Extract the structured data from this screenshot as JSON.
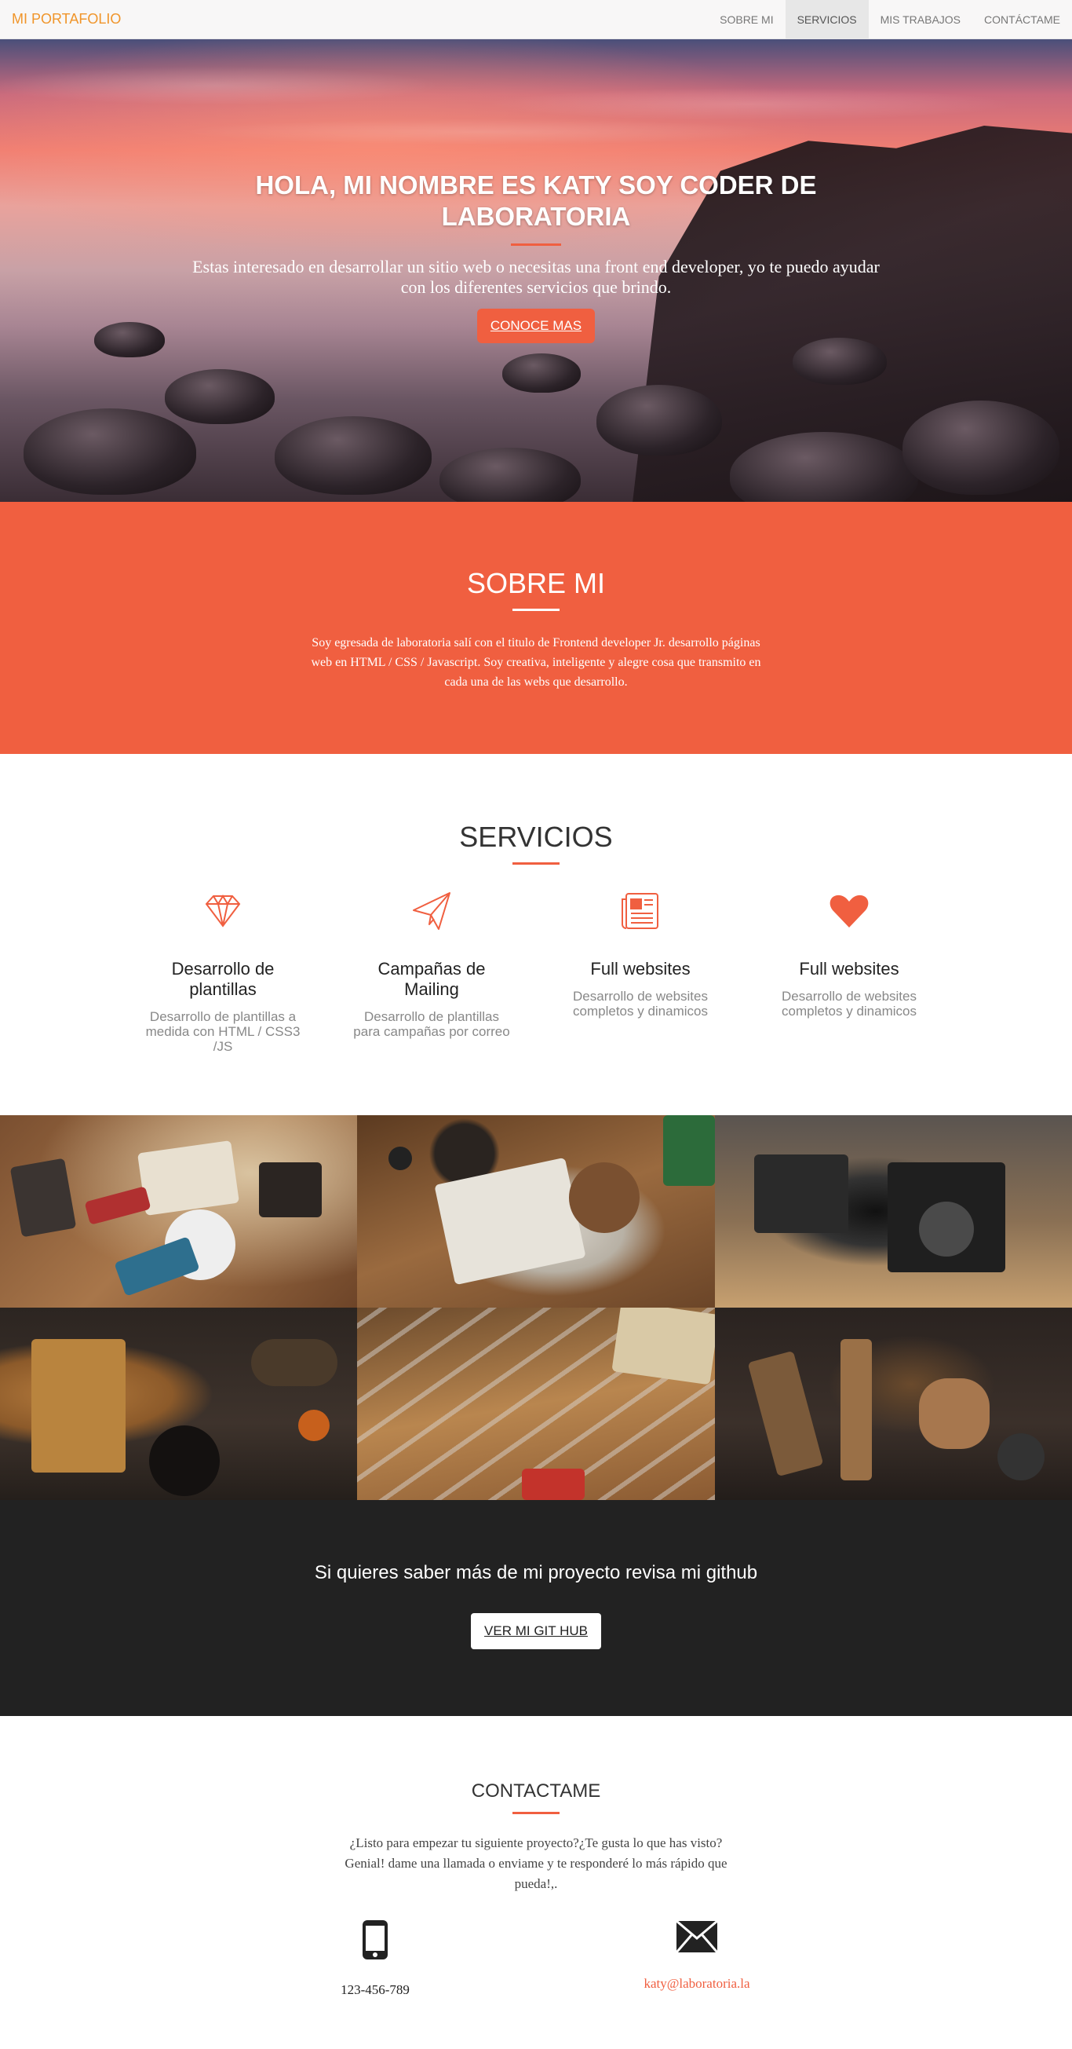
{
  "navbar": {
    "brand": "MI PORTAFOLIO",
    "links": [
      {
        "label": "SOBRE MI",
        "active": false
      },
      {
        "label": "SERVICIOS",
        "active": true
      },
      {
        "label": "MIS TRABAJOS",
        "active": false
      },
      {
        "label": "CONTÁCTAME",
        "active": false
      }
    ]
  },
  "hero": {
    "title": "HOLA, MI NOMBRE ES KATY SOY CODER DE LABORATORIA",
    "text": "Estas interesado en desarrollar un sitio web o necesitas una front end developer, yo te puedo ayudar con los diferentes servicios que brindo.",
    "button": "CONOCE MAS"
  },
  "about": {
    "title": "SOBRE MI",
    "text": "Soy egresada de laboratoria salí con el titulo de Frontend developer Jr. desarrollo páginas web en HTML / CSS / Javascript. Soy creativa, inteligente y alegre cosa que transmito en cada una de las webs que desarrollo."
  },
  "services": {
    "title": "SERVICIOS",
    "items": [
      {
        "icon": "diamond-icon",
        "title": "Desarrollo de plantillas",
        "text": "Desarrollo de plantillas a medida con HTML / CSS3 /JS"
      },
      {
        "icon": "paper-plane-icon",
        "title": "Campañas de Mailing",
        "text": "Desarrollo de plantillas para campañas por correo"
      },
      {
        "icon": "newspaper-icon",
        "title": "Full websites",
        "text": "Desarrollo de websites completos y dinamicos"
      },
      {
        "icon": "heart-icon",
        "title": "Full websites",
        "text": "Desarrollo de websites completos y dinamicos"
      }
    ]
  },
  "cta": {
    "title": "Si quieres saber más de mi proyecto revisa mi github",
    "button": "VER MI GIT HUB"
  },
  "contact": {
    "title": "CONTACTAME",
    "text": "¿Listo para empezar tu siguiente proyecto?¿Te gusta lo que has visto? Genial! dame una llamada o enviame y te responderé lo más rápido que pueda!,.",
    "phone": "123-456-789",
    "email": "katy@laboratoria.la"
  },
  "colors": {
    "accent": "#f05f40",
    "brand": "#f0952a",
    "dark": "#222222"
  }
}
